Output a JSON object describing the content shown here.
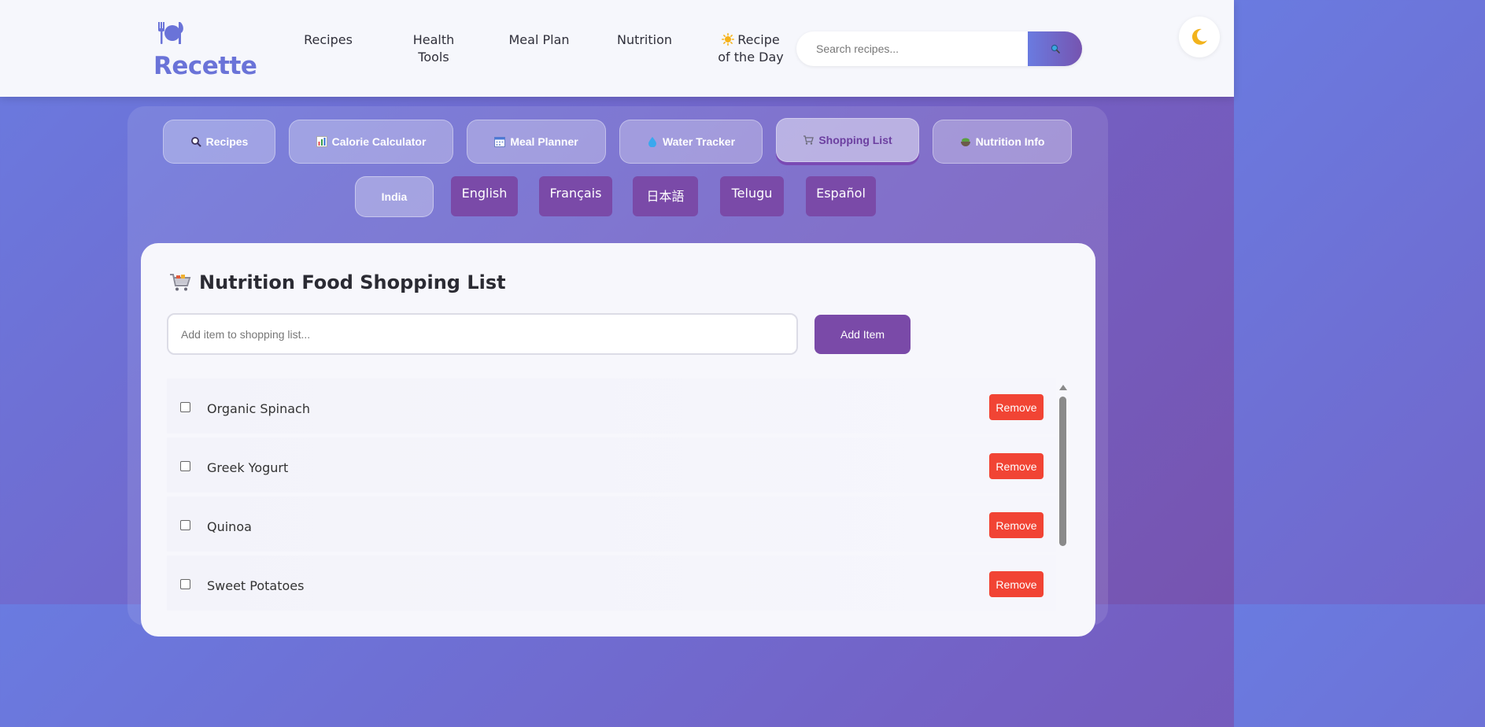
{
  "header": {
    "logo_text": "Recette",
    "logo_icon": "plate-cutlery-icon",
    "nav": {
      "recipes": "Recipes",
      "health_tools_1": "Health",
      "health_tools_2": "Tools",
      "meal_plan": "Meal Plan",
      "nutrition": "Nutrition",
      "rotd_1": "Recipe",
      "rotd_2": "of the Day"
    },
    "search": {
      "placeholder": "Search recipes...",
      "icon": "search-icon"
    },
    "theme_toggle_icon": "moon-icon"
  },
  "tabs": [
    {
      "label": "Recipes",
      "icon": "magnifier-icon"
    },
    {
      "label": "Calorie Calculator",
      "icon": "bar-chart-icon"
    },
    {
      "label": "Meal Planner",
      "icon": "calendar-icon"
    },
    {
      "label": "Water Tracker",
      "icon": "droplet-icon"
    },
    {
      "label": "Shopping List",
      "icon": "cart-icon",
      "active": true
    },
    {
      "label": "Nutrition Info",
      "icon": "salad-icon"
    }
  ],
  "languages": {
    "region": "India",
    "items": [
      "English",
      "Français",
      "日本語",
      "Telugu",
      "Español"
    ]
  },
  "shopping": {
    "title": "Nutrition Food Shopping List",
    "input_placeholder": "Add item to shopping list...",
    "add_label": "Add Item",
    "remove_label": "Remove",
    "items": [
      "Organic Spinach",
      "Greek Yogurt",
      "Quinoa",
      "Sweet Potatoes"
    ]
  },
  "colors": {
    "accent": "#7a4aa8",
    "brand": "#6a73d8",
    "danger": "#f14434"
  }
}
